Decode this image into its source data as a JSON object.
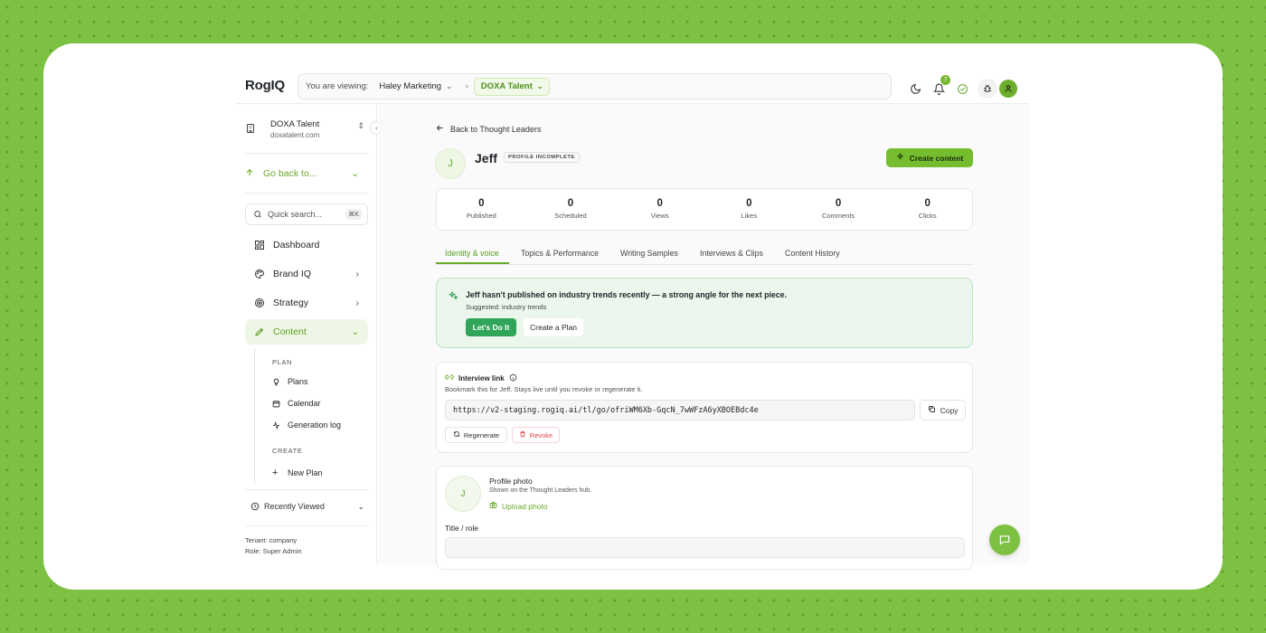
{
  "app": {
    "logo": "RogIQ"
  },
  "header": {
    "viewing_label": "You are viewing:",
    "org": "Haley Marketing",
    "breadcrumb_sep": "›",
    "talent": "DOXA Talent",
    "notification_count": "7"
  },
  "sidebar": {
    "tenant_name": "DOXA Talent",
    "tenant_domain": "doxatalent.com",
    "go_back": "Go back to...",
    "search_placeholder": "Quick search...",
    "search_shortcut": "⌘K",
    "nav": [
      {
        "label": "Dashboard"
      },
      {
        "label": "Brand IQ"
      },
      {
        "label": "Strategy"
      },
      {
        "label": "Content"
      }
    ],
    "plan_heading": "PLAN",
    "plan_items": [
      {
        "label": "Plans"
      },
      {
        "label": "Calendar"
      },
      {
        "label": "Generation log"
      }
    ],
    "create_heading": "CREATE",
    "create_items": [
      {
        "label": "New Plan"
      }
    ],
    "recently_viewed": "Recently Viewed",
    "tenant_line": "Tenant: company",
    "role_line": "Role: Super Admin"
  },
  "main": {
    "back_link": "Back to Thought Leaders",
    "avatar_initial": "J",
    "name": "Jeff",
    "profile_badge": "PROFILE INCOMPLETE",
    "create_button": "Create content",
    "stats": [
      {
        "value": "0",
        "label": "Published"
      },
      {
        "value": "0",
        "label": "Scheduled"
      },
      {
        "value": "0",
        "label": "Views"
      },
      {
        "value": "0",
        "label": "Likes"
      },
      {
        "value": "0",
        "label": "Comments"
      },
      {
        "value": "0",
        "label": "Clicks"
      }
    ],
    "tabs": [
      {
        "label": "Identity & voice"
      },
      {
        "label": "Topics & Performance"
      },
      {
        "label": "Writing Samples"
      },
      {
        "label": "Interviews & Clips"
      },
      {
        "label": "Content History"
      }
    ],
    "suggestion": {
      "text": "Jeff hasn't published on industry trends recently — a strong angle for the next piece.",
      "sub": "Suggested: industry trends",
      "primary": "Let's Do It",
      "secondary": "Create a Plan"
    },
    "interview": {
      "title": "Interview link",
      "desc": "Bookmark this for Jeff. Stays live until you revoke or regenerate it.",
      "url": "https://v2-staging.rogiq.ai/tl/go/ofriWM6Xb-GqcN_7wWFzA6yXBOEBdc4e",
      "copy": "Copy",
      "regenerate": "Regenerate",
      "revoke": "Revoke"
    },
    "photo": {
      "initial": "J",
      "title": "Profile photo",
      "sub": "Shown on the Thought Leaders hub.",
      "upload": "Upload photo",
      "role_label": "Title / role"
    }
  },
  "colors": {
    "accent": "#75bd2e",
    "page_bg": "#7cc142",
    "success": "#2fa55a",
    "danger": "#dd4444"
  }
}
